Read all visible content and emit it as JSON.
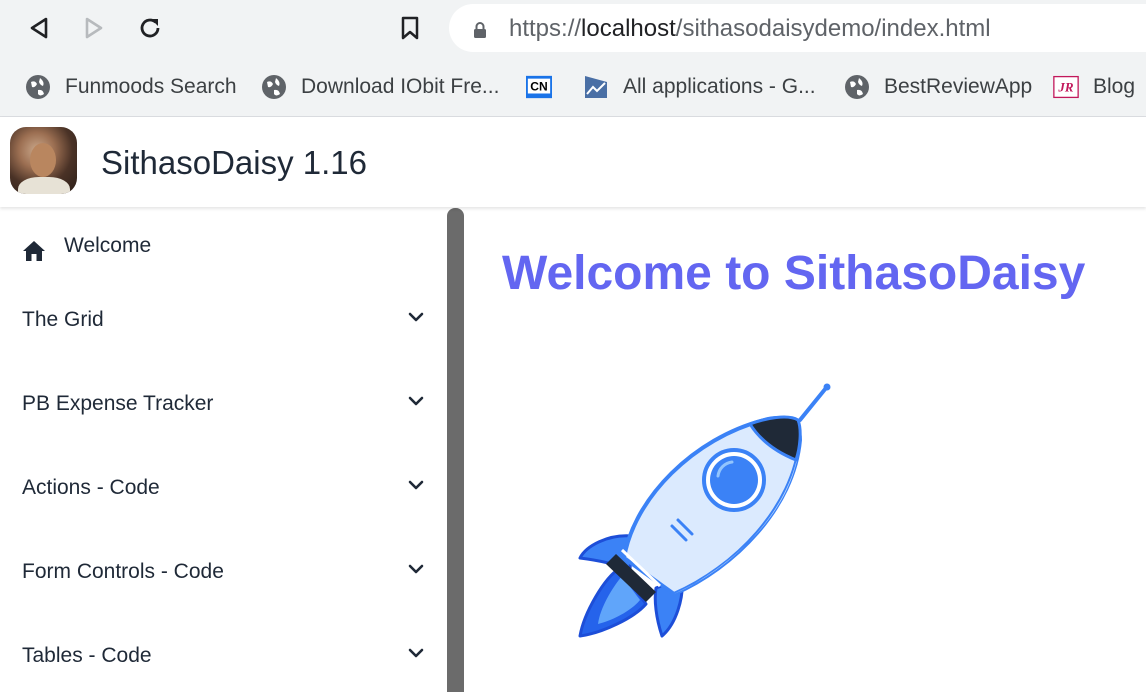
{
  "browser": {
    "url_prefix": "https://",
    "url_host": "localhost",
    "url_path": "/sithasodaisydemo/index.html"
  },
  "bookmarks": [
    {
      "label": "Funmoods Search",
      "icon": "globe-icon"
    },
    {
      "label": "Download IObit Fre...",
      "icon": "globe-icon"
    },
    {
      "label": "",
      "icon": "cn-logo-icon"
    },
    {
      "label": "All applications - G...",
      "icon": "chart-icon"
    },
    {
      "label": "BestReviewApp",
      "icon": "globe-icon"
    },
    {
      "label": "Blog",
      "icon": "jr-logo-icon"
    }
  ],
  "app": {
    "title": "SithasoDaisy 1.16"
  },
  "sidebar": {
    "items": [
      {
        "label": "Welcome",
        "icon": "home-icon"
      },
      {
        "label": "The Grid",
        "icon": "chevron-down-icon"
      },
      {
        "label": "PB Expense Tracker",
        "icon": "chevron-down-icon"
      },
      {
        "label": "Actions - Code",
        "icon": "chevron-down-icon"
      },
      {
        "label": "Form Controls - Code",
        "icon": "chevron-down-icon"
      },
      {
        "label": "Tables - Code",
        "icon": "chevron-down-icon"
      }
    ]
  },
  "main": {
    "heading": "Welcome to SithasoDaisy"
  },
  "colors": {
    "accent": "#6366f1",
    "rocket_blue": "#3b82f6",
    "scroll_thumb": "#6b6b6b"
  }
}
